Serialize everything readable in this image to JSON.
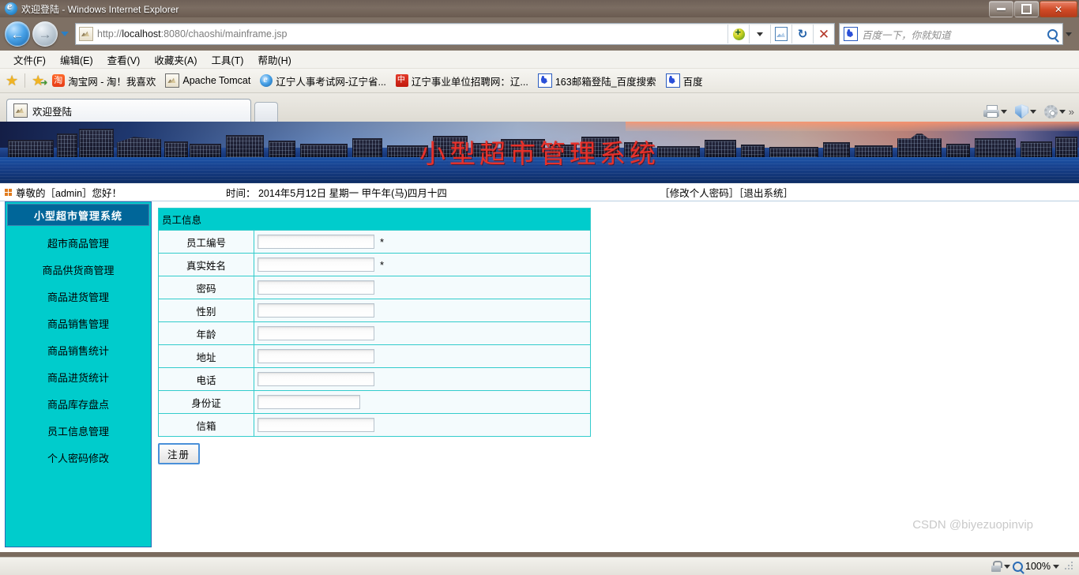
{
  "browser": {
    "window_title": "欢迎登陆 - Windows Internet Explorer",
    "url_prefix": "http://",
    "url_host": "localhost",
    "url_rest": ":8080/chaoshi/mainframe.jsp",
    "search_placeholder": "百度一下，你就知道",
    "menu": [
      {
        "label": "文件(F)"
      },
      {
        "label": "编辑(E)"
      },
      {
        "label": "查看(V)"
      },
      {
        "label": "收藏夹(A)"
      },
      {
        "label": "工具(T)"
      },
      {
        "label": "帮助(H)"
      }
    ],
    "favorites": [
      {
        "label": "淘宝网 - 淘！我喜欢",
        "icon": "taobao-icon"
      },
      {
        "label": "Apache Tomcat",
        "icon": "tomcat-icon"
      },
      {
        "label": "辽宁人事考试网-辽宁省...",
        "icon": "ie-icon"
      },
      {
        "label": "辽宁事业单位招聘网：辽...",
        "icon": "liaoning-icon"
      },
      {
        "label": "163邮箱登陆_百度搜索",
        "icon": "baidu-icon"
      },
      {
        "label": "百度",
        "icon": "baidu-icon"
      }
    ],
    "tab_label": "欢迎登陆",
    "window_controls": {
      "minimize": "minimize-icon",
      "restore": "restore-icon",
      "close": "✕"
    },
    "toolbar_icons": [
      "printer-icon",
      "shield-icon",
      "gear-icon",
      "chevron-double-right-icon"
    ],
    "address_icons": [
      "translate-icon",
      "compatibility-view-icon",
      "refresh-icon",
      "stop-icon"
    ]
  },
  "page": {
    "banner_title": "小型超市管理系统",
    "greeting": "尊敬的［admin］您好！",
    "time_info": "时间： 2014年5月12日 星期一 甲午年(马)四月十四",
    "account_links": "［修改个人密码］［退出系统］",
    "sidebar": {
      "title": "小型超市管理系统",
      "items": [
        {
          "label": "超市商品管理"
        },
        {
          "label": "商品供货商管理"
        },
        {
          "label": "商品进货管理"
        },
        {
          "label": "商品销售管理"
        },
        {
          "label": "商品销售统计"
        },
        {
          "label": "商品进货统计"
        },
        {
          "label": "商品库存盘点"
        },
        {
          "label": "员工信息管理"
        },
        {
          "label": "个人密码修改"
        }
      ]
    },
    "form": {
      "caption": "员工信息",
      "rows": [
        {
          "label": "员工编号",
          "value": "",
          "required": "*",
          "width": "normal"
        },
        {
          "label": "真实姓名",
          "value": "",
          "required": "*",
          "width": "normal"
        },
        {
          "label": "密码",
          "value": "",
          "required": "",
          "width": "normal"
        },
        {
          "label": "性别",
          "value": "",
          "required": "",
          "width": "normal"
        },
        {
          "label": "年龄",
          "value": "",
          "required": "",
          "width": "normal"
        },
        {
          "label": "地址",
          "value": "",
          "required": "",
          "width": "normal"
        },
        {
          "label": "电话",
          "value": "",
          "required": "",
          "width": "normal"
        },
        {
          "label": "身份证",
          "value": "",
          "required": "",
          "width": "short"
        },
        {
          "label": "信箱",
          "value": "",
          "required": "",
          "width": "normal"
        }
      ],
      "submit_label": "注册"
    }
  },
  "status": {
    "zoom": "100%",
    "watermark": "CSDN @biyezuopinvip"
  },
  "colors": {
    "sidebar_bg": "#00cccc",
    "sidebar_head": "#006699",
    "banner_title": "#e8312a",
    "table_border": "#33cccc"
  }
}
